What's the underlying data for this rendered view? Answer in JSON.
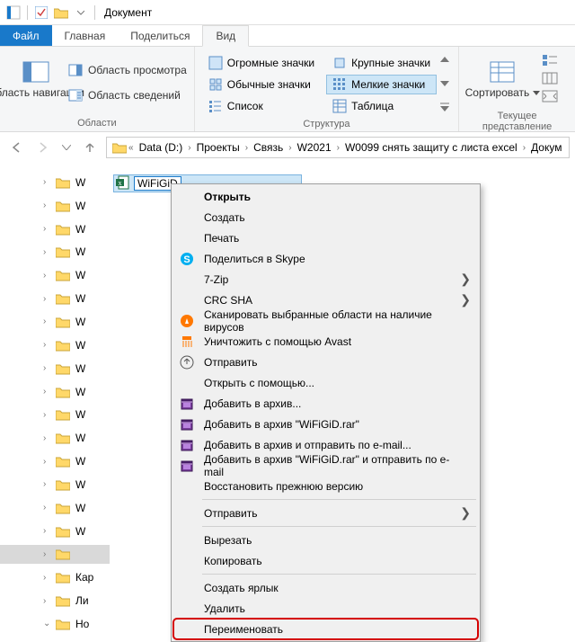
{
  "titlebar": {
    "title": "Документ"
  },
  "ribbon": {
    "tabs": {
      "file": "Файл",
      "home": "Главная",
      "share": "Поделиться",
      "view": "Вид"
    },
    "nav": {
      "big_label": "Область навигации",
      "preview_pane": "Область просмотра",
      "details_pane": "Область сведений",
      "group_label": "Области"
    },
    "layout": {
      "huge": "Огромные значки",
      "large": "Крупные значки",
      "normal": "Обычные значки",
      "small": "Мелкие значки",
      "list": "Список",
      "table": "Таблица",
      "group_label": "Структура"
    },
    "sort": {
      "label": "Сортировать",
      "group_label": "Текущее представление"
    }
  },
  "breadcrumbs": {
    "root": "Data (D:)",
    "p1": "Проекты",
    "p2": "Связь",
    "p3": "W2021",
    "p4": "W0099 снять защиту с листа excel",
    "p5": "Докум"
  },
  "tree": {
    "items": [
      {
        "label": "W"
      },
      {
        "label": "W"
      },
      {
        "label": "W"
      },
      {
        "label": "W"
      },
      {
        "label": "W"
      },
      {
        "label": "W"
      },
      {
        "label": "W"
      },
      {
        "label": "W"
      },
      {
        "label": "W"
      },
      {
        "label": "W"
      },
      {
        "label": "W"
      },
      {
        "label": "W"
      },
      {
        "label": "W"
      },
      {
        "label": "W"
      },
      {
        "label": "W"
      },
      {
        "label": "W"
      },
      {
        "label": ""
      },
      {
        "label": "Кар"
      },
      {
        "label": "Ли"
      },
      {
        "label": "Но"
      }
    ],
    "selected_index": 16,
    "expand_index": 19
  },
  "file": {
    "name": "WiFiGiD"
  },
  "context_menu": {
    "g1": [
      {
        "label": "Открыть",
        "bold": true,
        "icon": null,
        "sub": false
      },
      {
        "label": "Создать",
        "icon": null,
        "sub": false
      },
      {
        "label": "Печать",
        "icon": null,
        "sub": false
      },
      {
        "label": "Поделиться в Skype",
        "icon": "skype",
        "sub": false
      },
      {
        "label": "7-Zip",
        "icon": null,
        "sub": true
      },
      {
        "label": "CRC SHA",
        "icon": null,
        "sub": true
      },
      {
        "label": "Сканировать выбранные области на наличие вирусов",
        "icon": "avast",
        "sub": false
      },
      {
        "label": "Уничтожить с помощью Avast",
        "icon": "shred",
        "sub": false
      },
      {
        "label": "Отправить",
        "icon": "share",
        "sub": false
      },
      {
        "label": "Открыть с помощью...",
        "icon": null,
        "sub": false
      },
      {
        "label": "Добавить в архив...",
        "icon": "rar",
        "sub": false
      },
      {
        "label": "Добавить в архив \"WiFiGiD.rar\"",
        "icon": "rar",
        "sub": false
      },
      {
        "label": "Добавить в архив и отправить по e-mail...",
        "icon": "rar",
        "sub": false
      },
      {
        "label": "Добавить в архив \"WiFiGiD.rar\" и отправить по e-mail",
        "icon": "rar",
        "sub": false
      },
      {
        "label": "Восстановить прежнюю версию",
        "icon": null,
        "sub": false
      }
    ],
    "g2": [
      {
        "label": "Отправить",
        "icon": null,
        "sub": true
      }
    ],
    "g3": [
      {
        "label": "Вырезать",
        "icon": null,
        "sub": false
      },
      {
        "label": "Копировать",
        "icon": null,
        "sub": false
      }
    ],
    "g4": [
      {
        "label": "Создать ярлык",
        "icon": null,
        "sub": false
      },
      {
        "label": "Удалить",
        "icon": null,
        "sub": false
      },
      {
        "label": "Переименовать",
        "icon": null,
        "sub": false,
        "highlight": true
      }
    ]
  }
}
